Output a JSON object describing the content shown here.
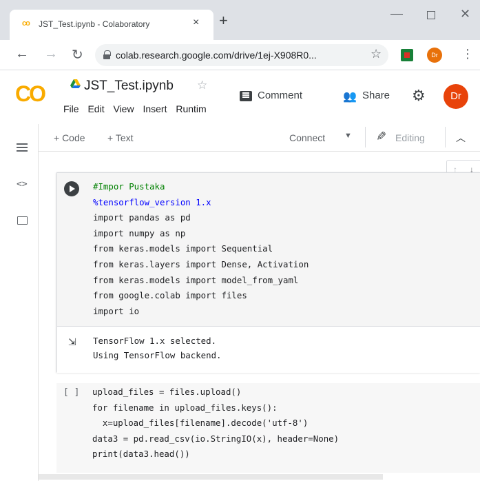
{
  "browser": {
    "tab_title": "JST_Test.ipynb - Colaboratory",
    "tab_favicon": "co",
    "close_glyph": "×",
    "new_tab_glyph": "+",
    "url": "colab.research.google.com/drive/1ej-X908R0...",
    "profile_initials": "Dr"
  },
  "colab": {
    "logo_text": "CO",
    "doc_title": "JST_Test.ipynb",
    "menu": [
      "File",
      "Edit",
      "View",
      "Insert",
      "Runtim"
    ],
    "comment_label": "Comment",
    "share_label": "Share",
    "avatar_initials": "Dr",
    "accent_color": "#f9ab00"
  },
  "nb_toolbar": {
    "add_code": "+ Code",
    "add_text": "+ Text",
    "connect": "Connect",
    "editing": "Editing"
  },
  "cells": [
    {
      "execution": "",
      "lines": [
        "#Impor Pustaka",
        "%tensorflow_version 1.x",
        "import pandas as pd",
        "import numpy as np",
        "from keras.models import Sequential",
        "from keras.layers import Dense, Activation",
        "from keras.models import model_from_yaml",
        "from google.colab import files",
        "import io"
      ],
      "output": [
        "TensorFlow 1.x selected.",
        "Using TensorFlow backend."
      ]
    },
    {
      "execution": "[ ]",
      "lines": [
        "upload_files = files.upload()",
        "for filename in upload_files.keys():",
        "  x=upload_files[filename].decode('utf-8')",
        "data3 = pd.read_csv(io.StringIO(x), header=None)",
        "print(data3.head())"
      ]
    }
  ]
}
